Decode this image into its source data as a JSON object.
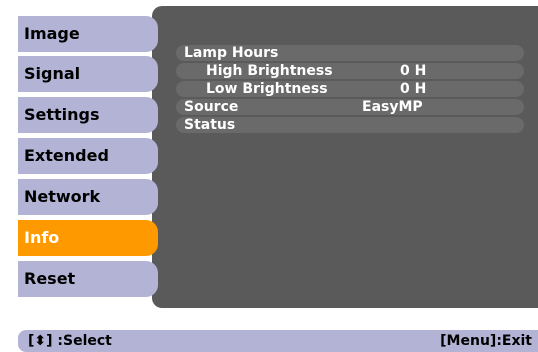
{
  "menu": {
    "items": [
      {
        "label": "Image",
        "active": false
      },
      {
        "label": "Signal",
        "active": false
      },
      {
        "label": "Settings",
        "active": false
      },
      {
        "label": "Extended",
        "active": false
      },
      {
        "label": "Network",
        "active": false
      },
      {
        "label": "Info",
        "active": true
      },
      {
        "label": "Reset",
        "active": false
      }
    ]
  },
  "info_panel": {
    "lamp_hours_label": "Lamp Hours",
    "high_brightness_label": "High Brightness",
    "high_brightness_value": "0 H",
    "low_brightness_label": "Low Brightness",
    "low_brightness_value": "0 H",
    "source_label": "Source",
    "source_value": "EasyMP",
    "status_label": "Status"
  },
  "footer": {
    "select_hint": "[⬍] :Select",
    "exit_hint": "[Menu]:Exit"
  },
  "colors": {
    "menu_bg": "#b3b3d6",
    "menu_active": "#ff9900",
    "panel_bg": "#5a5a5a",
    "row_bg": "#6a6a6a"
  }
}
